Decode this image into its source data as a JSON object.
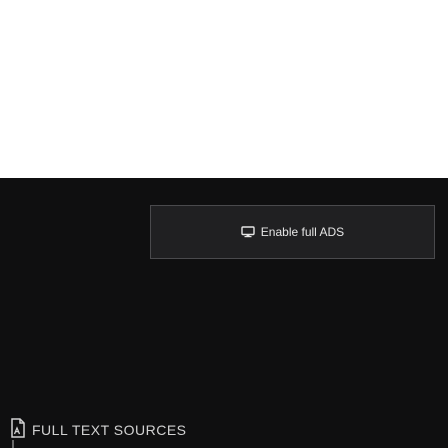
{
  "colors": {
    "panel_background": "#0f0f10",
    "button_background": "#202022",
    "button_border": "#4a4a4d",
    "text": "#e6e6e6"
  },
  "enable_button": {
    "icon": "monitor-icon",
    "label": "Enable full ADS"
  },
  "sources_section": {
    "icon": "document-icon",
    "label": "FULL TEXT SOURCES"
  }
}
